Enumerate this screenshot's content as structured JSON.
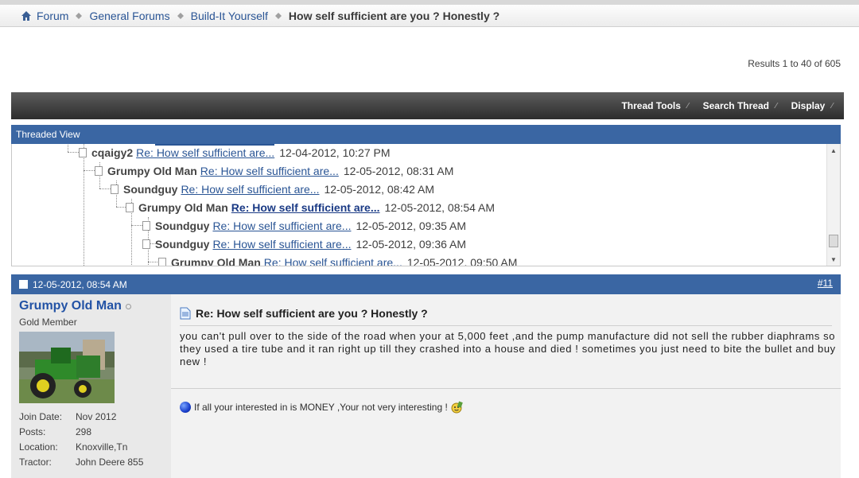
{
  "breadcrumb": {
    "items": [
      "Forum",
      "General Forums",
      "Build-It Yourself"
    ],
    "current": "How self sufficient are you ? Honestly ?"
  },
  "results": "Results 1 to 40 of 605",
  "toolbar": {
    "thread_tools": "Thread Tools",
    "search_thread": "Search Thread",
    "display": "Display"
  },
  "threaded_view": {
    "title": "Threaded View",
    "rows": [
      {
        "user": "cqaigy2",
        "link": "Re: How self sufficient are...",
        "date": "12-04-2012, 10:27 PM"
      },
      {
        "user": "Grumpy Old Man",
        "link": "Re: How self sufficient are...",
        "date": "12-05-2012, 08:31 AM"
      },
      {
        "user": "Soundguy",
        "link": "Re: How self sufficient are...",
        "date": "12-05-2012, 08:42 AM"
      },
      {
        "user": "Grumpy Old Man",
        "link": "Re: How self sufficient are...",
        "date": "12-05-2012, 08:54 AM"
      },
      {
        "user": "Soundguy",
        "link": "Re: How self sufficient are...",
        "date": "12-05-2012, 09:35 AM"
      },
      {
        "user": "Soundguy",
        "link": "Re: How self sufficient are...",
        "date": "12-05-2012, 09:36 AM"
      },
      {
        "user": "Grumpy Old Man",
        "link": "Re: How self sufficient are...",
        "date": "12-05-2012, 09:50 AM"
      }
    ]
  },
  "post": {
    "date": "12-05-2012, 08:54 AM",
    "number": "#11",
    "user": {
      "name": "Grumpy Old Man",
      "title": "Gold Member",
      "stats": [
        {
          "label": "Join Date:",
          "value": "Nov 2012"
        },
        {
          "label": "Posts:",
          "value": "298"
        },
        {
          "label": "Location:",
          "value": "Knoxville,Tn"
        },
        {
          "label": "Tractor:",
          "value": "John Deere 855"
        }
      ]
    },
    "title": "Re: How self sufficient are you ? Honestly ?",
    "body": "you can't pull over to the side of the road when your at 5,000 feet ,and the pump manufacture did not sell the rubber diaphrams so they used a tire tube and it ran right up till they crashed into a house and died ! sometimes you just need to bite the bullet and buy new !",
    "signature": "If all your interested in is MONEY ,Your not very interesting !"
  },
  "colors": {
    "header_blue": "#3a66a3",
    "link_blue": "#2a5595",
    "toolbar_dark": "#2d2d2d"
  }
}
